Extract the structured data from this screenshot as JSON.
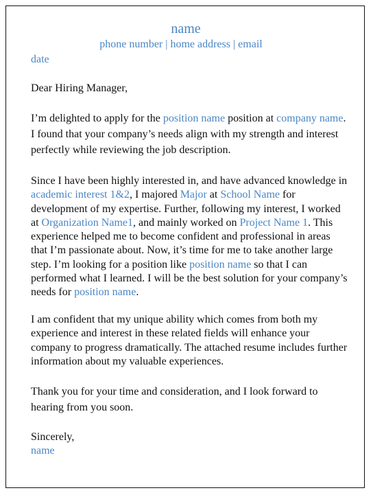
{
  "header": {
    "name": "name",
    "contact": "phone number | home address | email",
    "date": "date"
  },
  "letter": {
    "salutation": "Dear Hiring Manager,",
    "p1": {
      "t1": "I’m delighted to apply for the ",
      "position": "position name",
      "t2": " position at ",
      "company": "company name",
      "t3": ". I found that your company’s needs align with my strength and interest perfectly while reviewing the job description."
    },
    "p2": {
      "t1": "Since I have been highly interested in, and have advanced knowledge in  ",
      "interest": "academic interest 1&2",
      "t2": ", I majored ",
      "major": "Major",
      "t3": " at ",
      "school": "School Name",
      "t4": " for development of my expertise. Further, following my interest, I worked at ",
      "org": "Organization Name1",
      "t5": ", and mainly worked on ",
      "project": "Project Name 1",
      "t6": ". This experience helped me to become confident and professional in areas that I’m passionate about. Now, it’s time for me to take another large step. I’m looking for a position like ",
      "position1": "position name",
      "t7": " so that I can performed what I learned. I will be the best solution for your company’s needs for ",
      "position2": "position name",
      "t8": "."
    },
    "p3": "I am confident that my unique ability which comes from both my experience and interest in these related fields will enhance your company to progress dramatically. The attached resume includes further information about my valuable experiences.",
    "p4": "Thank you for your time and consideration, and I look forward to hearing from you soon.",
    "closing": "Sincerely,",
    "signature": "name"
  }
}
